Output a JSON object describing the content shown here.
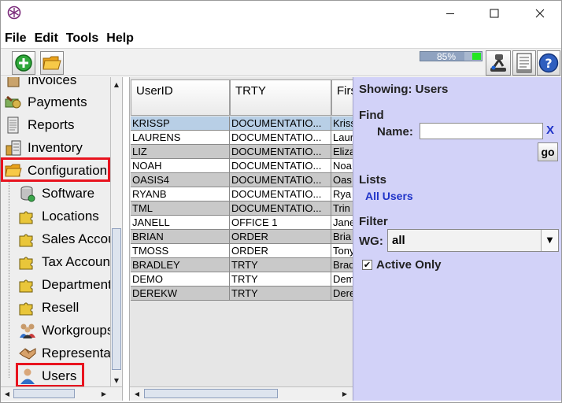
{
  "window": {
    "minimize_icon": "minimize-icon",
    "maximize_icon": "maximize-icon",
    "close_icon": "close-icon"
  },
  "menu": [
    "File",
    "Edit",
    "Tools",
    "Help"
  ],
  "toolbar": {
    "progress_text": "85%",
    "progress_value": 85,
    "icons": [
      "add-icon",
      "folder-icon",
      "robot-icon",
      "document-icon",
      "help-icon"
    ]
  },
  "tree": {
    "items": [
      {
        "label": "Invoices",
        "icon": "invoice-icon",
        "level": 0
      },
      {
        "label": "Payments",
        "icon": "payments-icon",
        "level": 0
      },
      {
        "label": "Reports",
        "icon": "reports-icon",
        "level": 0
      },
      {
        "label": "Inventory",
        "icon": "inventory-icon",
        "level": 0
      },
      {
        "label": "Configuration",
        "icon": "folder-icon",
        "level": 0,
        "highlighted": true
      },
      {
        "label": "Software",
        "icon": "database-icon",
        "level": 1
      },
      {
        "label": "Locations",
        "icon": "puzzle-icon",
        "level": 1
      },
      {
        "label": "Sales Accounts",
        "icon": "puzzle-icon",
        "level": 1
      },
      {
        "label": "Tax Accounts",
        "icon": "puzzle-icon",
        "level": 1
      },
      {
        "label": "Departments",
        "icon": "puzzle-icon",
        "level": 1
      },
      {
        "label": "Resell",
        "icon": "puzzle-icon",
        "level": 1
      },
      {
        "label": "Workgroups",
        "icon": "group-icon",
        "level": 1
      },
      {
        "label": "Representatives",
        "icon": "handshake-icon",
        "level": 1
      },
      {
        "label": "Users",
        "icon": "user-icon",
        "level": 1,
        "highlighted": true,
        "selected": true
      }
    ]
  },
  "table": {
    "columns": [
      "UserID",
      "TRTY",
      "First"
    ],
    "rows": [
      [
        "KRISSP",
        "DOCUMENTATIO...",
        "Kriss"
      ],
      [
        "LAURENS",
        "DOCUMENTATIO...",
        "Laur"
      ],
      [
        "LIZ",
        "DOCUMENTATIO...",
        "Eliza"
      ],
      [
        "NOAH",
        "DOCUMENTATIO...",
        "Noa"
      ],
      [
        "OASIS4",
        "DOCUMENTATIO...",
        "Oas"
      ],
      [
        "RYANB",
        "DOCUMENTATIO...",
        "Rya"
      ],
      [
        "TML",
        "DOCUMENTATIO...",
        "Trin"
      ],
      [
        "JANELL",
        "OFFICE 1",
        "Jane"
      ],
      [
        "BRIAN",
        "ORDER",
        "Bria"
      ],
      [
        "TMOSS",
        "ORDER",
        "Tony"
      ],
      [
        "BRADLEY",
        "TRTY",
        "Brad"
      ],
      [
        "DEMO",
        "TRTY",
        "Dem"
      ],
      [
        "DEREKW",
        "TRTY",
        "Dere"
      ]
    ],
    "selected_row": 0
  },
  "panel": {
    "showing": "Showing: Users",
    "find_label": "Find",
    "name_label": "Name:",
    "name_value": "",
    "clear_label": "X",
    "go_label": "go",
    "lists_label": "Lists",
    "all_users_label": "All Users",
    "filter_label": "Filter",
    "wg_label": "WG:",
    "wg_value": "all",
    "active_only_label": "Active Only",
    "active_only_checked": true,
    "checkmark": "✔"
  }
}
